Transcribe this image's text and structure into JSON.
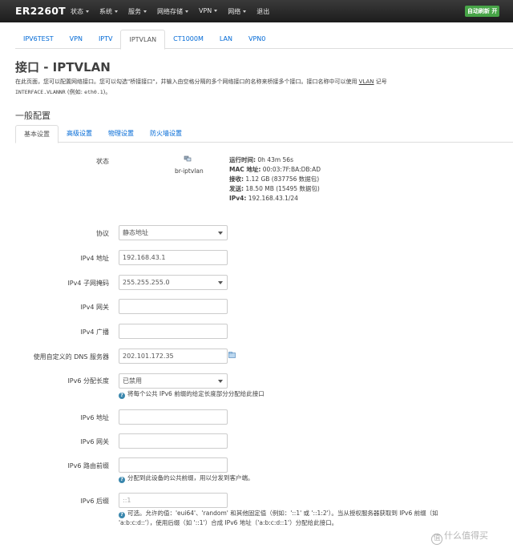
{
  "brand": "ER2260T",
  "nav": [
    "状态",
    "系统",
    "服务",
    "网络存储",
    "VPN",
    "网络",
    "退出"
  ],
  "autorefresh_label": "自动刷新 开",
  "iface_tabs": [
    "IPV6TEST",
    "VPN",
    "IPTV",
    "IPTVLAN",
    "CT1000M",
    "LAN",
    "VPN0"
  ],
  "active_iface_tab": "IPTVLAN",
  "page_title": "接口 - IPTVLAN",
  "description": {
    "line1_a": "在此页面，您可以配置网络接口。您可以勾选\"桥接接口\"，并输入由空格分隔的多个网络接口的名称来桥接多个接口。接口名称中可以使用 ",
    "line1_vlan": "VLAN",
    "line1_b": " 记号",
    "line2_mono": "INTERFACE.VLANNR",
    "line2_a": " (例如: ",
    "line2_mono2": "eth0.1",
    "line2_b": ")。"
  },
  "section_title": "一般配置",
  "sub_tabs": [
    "基本设置",
    "高级设置",
    "物理设置",
    "防火墙设置"
  ],
  "active_sub_tab": "基本设置",
  "status": {
    "label": "状态",
    "iface_name": "br-iptvlan",
    "uptime_key": "运行时间:",
    "uptime_val": " 0h 43m 56s",
    "mac_key": "MAC 地址:",
    "mac_val": " 00:03:7F:BA:DB:AD",
    "rx_key": "接收:",
    "rx_val": " 1.12 GB (837756 数据包)",
    "tx_key": "发送:",
    "tx_val": " 18.50 MB (15495 数据包)",
    "ipv4_key": "IPv4:",
    "ipv4_val": " 192.168.43.1/24"
  },
  "form": {
    "protocol_label": "协议",
    "protocol_value": "静态地址",
    "ipv4_addr_label": "IPv4 地址",
    "ipv4_addr_value": "192.168.43.1",
    "netmask_label": "IPv4 子网掩码",
    "netmask_value": "255.255.255.0",
    "gateway_label": "IPv4 网关",
    "gateway_value": "",
    "broadcast_label": "IPv4 广播",
    "broadcast_value": "",
    "dns_label": "使用自定义的 DNS 服务器",
    "dns_value": "202.101.172.35",
    "ip6assign_label": "IPv6 分配长度",
    "ip6assign_value": "已禁用",
    "ip6assign_hint": "将每个公共 IPv6 前缀的给定长度部分分配给此接口",
    "ipv6_addr_label": "IPv6 地址",
    "ipv6_addr_value": "",
    "ipv6_gw_label": "IPv6 网关",
    "ipv6_gw_value": "",
    "ipv6_prefix_label": "IPv6 路由前缀",
    "ipv6_prefix_value": "",
    "ipv6_prefix_hint": "分配到此设备的公共前缀，用以分发到客户端。",
    "ipv6_suffix_label": "IPv6 后缀",
    "ipv6_suffix_placeholder": "::1",
    "ipv6_suffix_hint_1": "可选。允许的值：'eui64'、'random' 和其他固定值（例如：'::1' 或 '::1:2'）。当从授权服务器获取到 IPv6 前缀（如",
    "ipv6_suffix_hint_2": "'a:b:c:d::'），使用后缀（如 '::1'）合成 IPv6 地址（'a:b:c:d::1'）分配给此接口。"
  },
  "watermark": "什么值得买"
}
